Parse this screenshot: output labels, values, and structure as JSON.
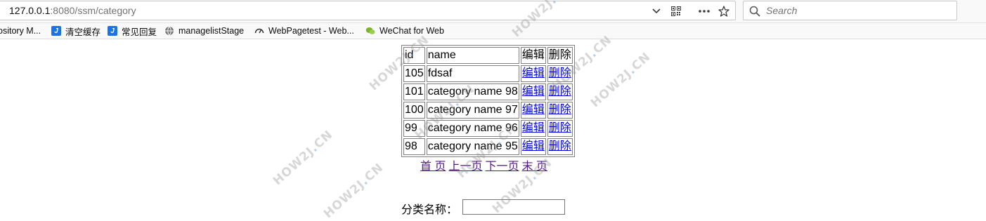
{
  "browser": {
    "url_host": "127.0.0.1",
    "url_rest": ":8080/ssm/category",
    "search_placeholder": "Search"
  },
  "bookmarks": [
    {
      "label": "ository M...",
      "icon": "none"
    },
    {
      "label": "清空缓存",
      "icon": "j-app-icon"
    },
    {
      "label": "常见回复",
      "icon": "j-app-icon"
    },
    {
      "label": "managelistStage",
      "icon": "globe-icon"
    },
    {
      "label": "WebPagetest - Web...",
      "icon": "speedometer-icon"
    },
    {
      "label": "WeChat for Web",
      "icon": "wechat-icon"
    }
  ],
  "table": {
    "headers": [
      "id",
      "name",
      "编辑",
      "删除"
    ],
    "rows": [
      {
        "id": "105",
        "name": "fdsaf",
        "edit": "编辑",
        "delete": "删除"
      },
      {
        "id": "101",
        "name": "category name 98",
        "edit": "编辑",
        "delete": "删除"
      },
      {
        "id": "100",
        "name": "category name 97",
        "edit": "编辑",
        "delete": "删除"
      },
      {
        "id": "99",
        "name": "category name 96",
        "edit": "编辑",
        "delete": "删除"
      },
      {
        "id": "98",
        "name": "category name 95",
        "edit": "编辑",
        "delete": "删除"
      }
    ]
  },
  "pager": {
    "first": "首 页",
    "prev": "上一页",
    "next": "下一页",
    "last": "末 页"
  },
  "form": {
    "label": "分类名称：",
    "value": ""
  },
  "watermark": {
    "text_a": "HOW2J",
    "text_b": "CN"
  },
  "colors": {
    "link": "#0000ee",
    "visited_link": "#551a8b",
    "chrome_bg": "#f9f9fa"
  }
}
